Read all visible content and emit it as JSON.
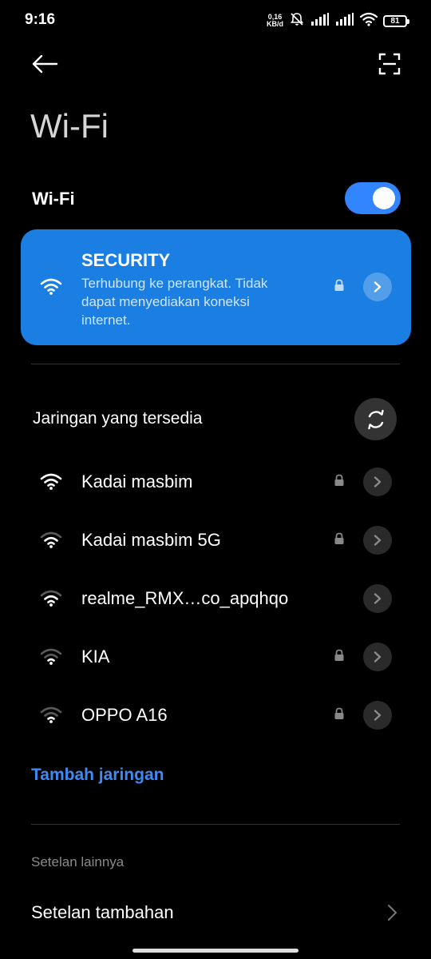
{
  "status": {
    "time": "9:16",
    "speed_value": "0,16",
    "speed_unit": "KB/d",
    "battery": "81"
  },
  "page": {
    "title": "Wi-Fi"
  },
  "wifi_toggle": {
    "label": "Wi-Fi",
    "enabled": true,
    "accent_color": "#3385ff"
  },
  "connected": {
    "name": "SECURITY",
    "description": "Terhubung ke perangkat. Tidak dapat menyediakan koneksi internet.",
    "card_color": "#1a7ee3"
  },
  "available": {
    "title": "Jaringan yang tersedia",
    "networks": [
      {
        "name": "Kadai masbim",
        "locked": true
      },
      {
        "name": "Kadai masbim 5G",
        "locked": true
      },
      {
        "name": "realme_RMX…co_apqhqo",
        "locked": false
      },
      {
        "name": "KIA",
        "locked": true
      },
      {
        "name": "OPPO A16",
        "locked": true
      }
    ]
  },
  "add_network_label": "Tambah jaringan",
  "more_settings": {
    "section_label": "Setelan lainnya",
    "additional_label": "Setelan tambahan"
  }
}
